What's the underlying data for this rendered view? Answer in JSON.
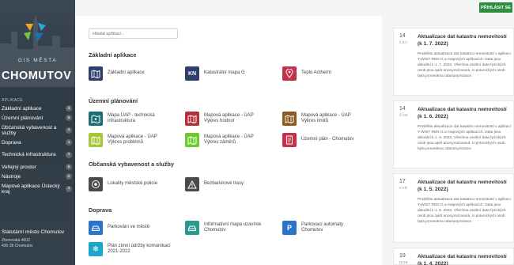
{
  "header": {
    "login_label": "PŘIHLÁSIT SE"
  },
  "sidebar": {
    "gis": "GIS MĚSTA",
    "city": "CHOMUTOV",
    "apps_label": "APLIKACE",
    "items": [
      {
        "label": "Základní aplikace",
        "count": "3"
      },
      {
        "label": "Územní plánování",
        "count": "6"
      },
      {
        "label": "Občanská vybavenost a služby",
        "count": "2"
      },
      {
        "label": "Doprava",
        "count": "4"
      },
      {
        "label": "Technická infrastruktura",
        "count": "3"
      },
      {
        "label": "Veřejný prostor",
        "count": "5"
      },
      {
        "label": "Nástroje",
        "count": "2"
      },
      {
        "label": "Mapové aplikace Ústecký kraj",
        "count": "3"
      }
    ],
    "footer": {
      "org": "Statutární město Chomutov",
      "street": "Zborovská 4602",
      "zip": "430 28 Chomutov"
    }
  },
  "search": {
    "placeholder": "Hledat aplikaci..."
  },
  "sections": {
    "zakladni": {
      "title": "Základní aplikace",
      "apps": [
        "Základní aplikace",
        "Katastrální mapa G",
        "Teplo Actherm"
      ]
    },
    "uzemni": {
      "title": "Územní plánování",
      "apps": [
        "Mapa ÚAP - technická infrastruktura",
        "Mapová aplikace - ÚAP Výkres hodnot",
        "Mapová aplikace - ÚAP Výkres limitů",
        "Mapová aplikace - ÚAP Výkres problémů",
        "Mapová aplikace - ÚAP Výkres záměrů",
        "Územní plán - Chomutov"
      ]
    },
    "obcanska": {
      "title": "Občanská vybavenost a služby",
      "apps": [
        "Lokality městské policie",
        "Bezbariérové trasy"
      ]
    },
    "doprava": {
      "title": "Doprava",
      "apps": [
        "Parkování ve městě",
        "Informativní mapa uzavírek Chomutov",
        "Parkovací automaty Chomutov",
        "Plán zimní údržby komunikací 2021-2022"
      ]
    }
  },
  "icons": {
    "zakladni": "map-icon",
    "katastr": "kn-icon",
    "teplo": "location-pin-icon",
    "accent_colors": {
      "navy": "#2f3f6b",
      "teal": "#1d6f77",
      "red": "#b6303c",
      "brown": "#8a5a1f",
      "lime": "#a8c63a",
      "green": "#6ccb2a",
      "gray": "#4b4b4b",
      "blue": "#2a73c9",
      "cyan": "#1da6c8",
      "rose": "#c4314b"
    }
  },
  "news": [
    {
      "day": "14",
      "month": "ČEC",
      "title": "Aktualizace dat katastru nemovitostí (k 1. 7. 2022)",
      "text": "Proběhla aktualizace dat katastru nemovitostí v aplikaci T-WIST REN G a mapových aplikacích. Data jsou aktuální k 1. 7. 2022. Všechna osobní data fyzických osob jsou opět anonymizovaná. U právnických osob byla provedena odanonymizace."
    },
    {
      "day": "14",
      "month": "ČVN",
      "title": "Aktualizace dat katastru nemovitostí (k 1. 6. 2022)",
      "text": "Proběhla aktualizace dat katastru nemovitostí v aplikaci T-WIST REN G a mapových aplikacích. Data jsou aktuální k 1. 6. 2022. Všechna osobní data fyzických osob jsou opět anonymizovaná. U právnických osob byla provedena odanonymizace."
    },
    {
      "day": "17",
      "month": "KVĚ",
      "title": "Aktualizace dat katastru nemovitostí (k 1. 5. 2022)",
      "text": "Proběhla aktualizace dat katastru nemovitostí v aplikaci T-WIST REN G a mapových aplikacích. Data jsou aktuální k 1. 5. 2022. Všechna osobní data fyzických osob jsou opět anonymizovaná. U právnických osob byla provedena odanonymizace."
    },
    {
      "day": "19",
      "month": "DUB",
      "title": "Aktualizace dat katastru nemovitostí (k 1. 4. 2022)"
    }
  ]
}
